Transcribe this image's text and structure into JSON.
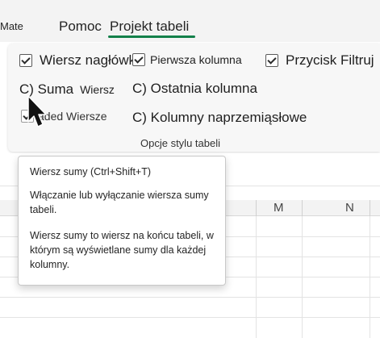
{
  "tabs": {
    "partial_left": "Mate",
    "help": "Pomoc",
    "active": "Projekt tabeli"
  },
  "ribbon": {
    "options": {
      "header_row": {
        "label": "Wiersz nagłówka",
        "checked": true
      },
      "first_column": {
        "label": "Pierwsza kolumna",
        "checked": true
      },
      "filter_button": {
        "label": "Przycisk Filtruj",
        "checked": true
      },
      "total_row_prefix": "C) Suma",
      "total_row_text": "Wiersz",
      "last_column": "C) Ostatnia kolumna",
      "banded_rows": {
        "label": "Naprzemiennie Wiersze",
        "visible_label": "aded Wiersze",
        "checked": true
      },
      "banded_columns": "C) Kolumny naprzemiąsłowe"
    },
    "group_label": "Opcje stylu tabeli"
  },
  "grid": {
    "columns": [
      "M",
      "N"
    ]
  },
  "tooltip": {
    "title": "Wiersz sumy (Ctrl+Shift+T)",
    "line1": "Włączanie lub wyłączanie wiersza sumy tabeli.",
    "line2": "Wiersz sumy to wiersz na końcu tabeli, w którym są wyświetlane sumy dla każdej kolumny."
  },
  "colors": {
    "accent": "#13804a",
    "ribbon_bg": "#f7f7f7",
    "tab_bg": "#f3f3f3"
  },
  "icons": {
    "cursor": "mouse-pointer-icon"
  }
}
